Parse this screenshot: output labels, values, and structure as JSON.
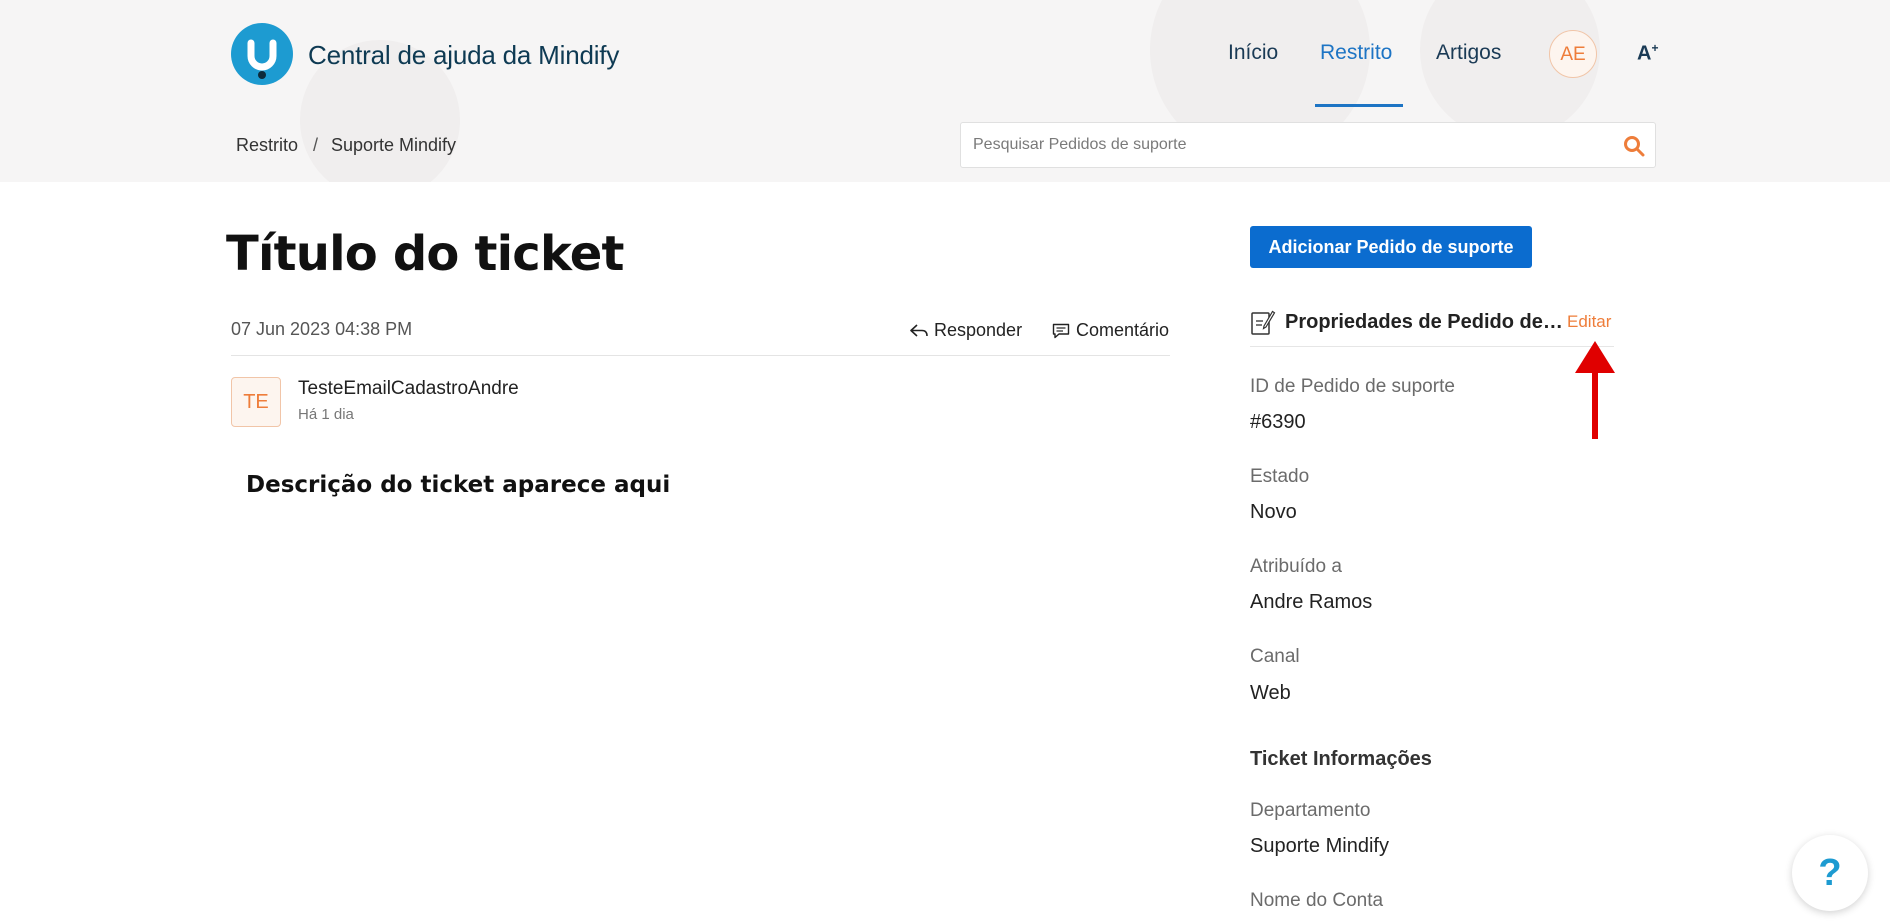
{
  "header": {
    "brand_name": "Central de ajuda da Mindify",
    "nav": [
      "Início",
      "Restrito",
      "Artigos"
    ],
    "active_nav": "Restrito",
    "user_initials": "AE",
    "text_size_glyph": "A"
  },
  "breadcrumb": [
    "Restrito",
    "Suporte Mindify"
  ],
  "breadcrumb_separator": "/",
  "search": {
    "placeholder": "Pesquisar Pedidos de suporte",
    "value": ""
  },
  "ticket": {
    "title": "Título do ticket",
    "date": "07 Jun 2023 04:38 PM",
    "actions": {
      "reply": "Responder",
      "comment": "Comentário"
    },
    "author": {
      "initials": "TE",
      "name": "TesteEmailCadastroAndre",
      "time": "Há 1 dia"
    },
    "description": "Descrição do ticket aparece aqui"
  },
  "sidebar": {
    "add_button": "Adicionar Pedido de suporte",
    "properties_title": "Propriedades de Pedido de suporte",
    "edit_label": "Editar",
    "fields": [
      {
        "label": "ID de Pedido de suporte",
        "value": "#6390"
      },
      {
        "label": "Estado",
        "value": "Novo"
      },
      {
        "label": "Atribuído a",
        "value": "Andre Ramos"
      },
      {
        "label": "Canal",
        "value": "Web"
      }
    ],
    "info_title": "Ticket Informações",
    "info_fields": [
      {
        "label": "Departamento",
        "value": "Suporte Mindify"
      },
      {
        "label": "Nome do Conta",
        "value": ""
      }
    ]
  },
  "help_button": "?",
  "colors": {
    "brand_blue": "#1d9bd1",
    "nav_active": "#1d74c4",
    "button_blue": "#0b6ccf",
    "accent_orange": "#ee7d3a",
    "annotation_red": "#e00000"
  }
}
